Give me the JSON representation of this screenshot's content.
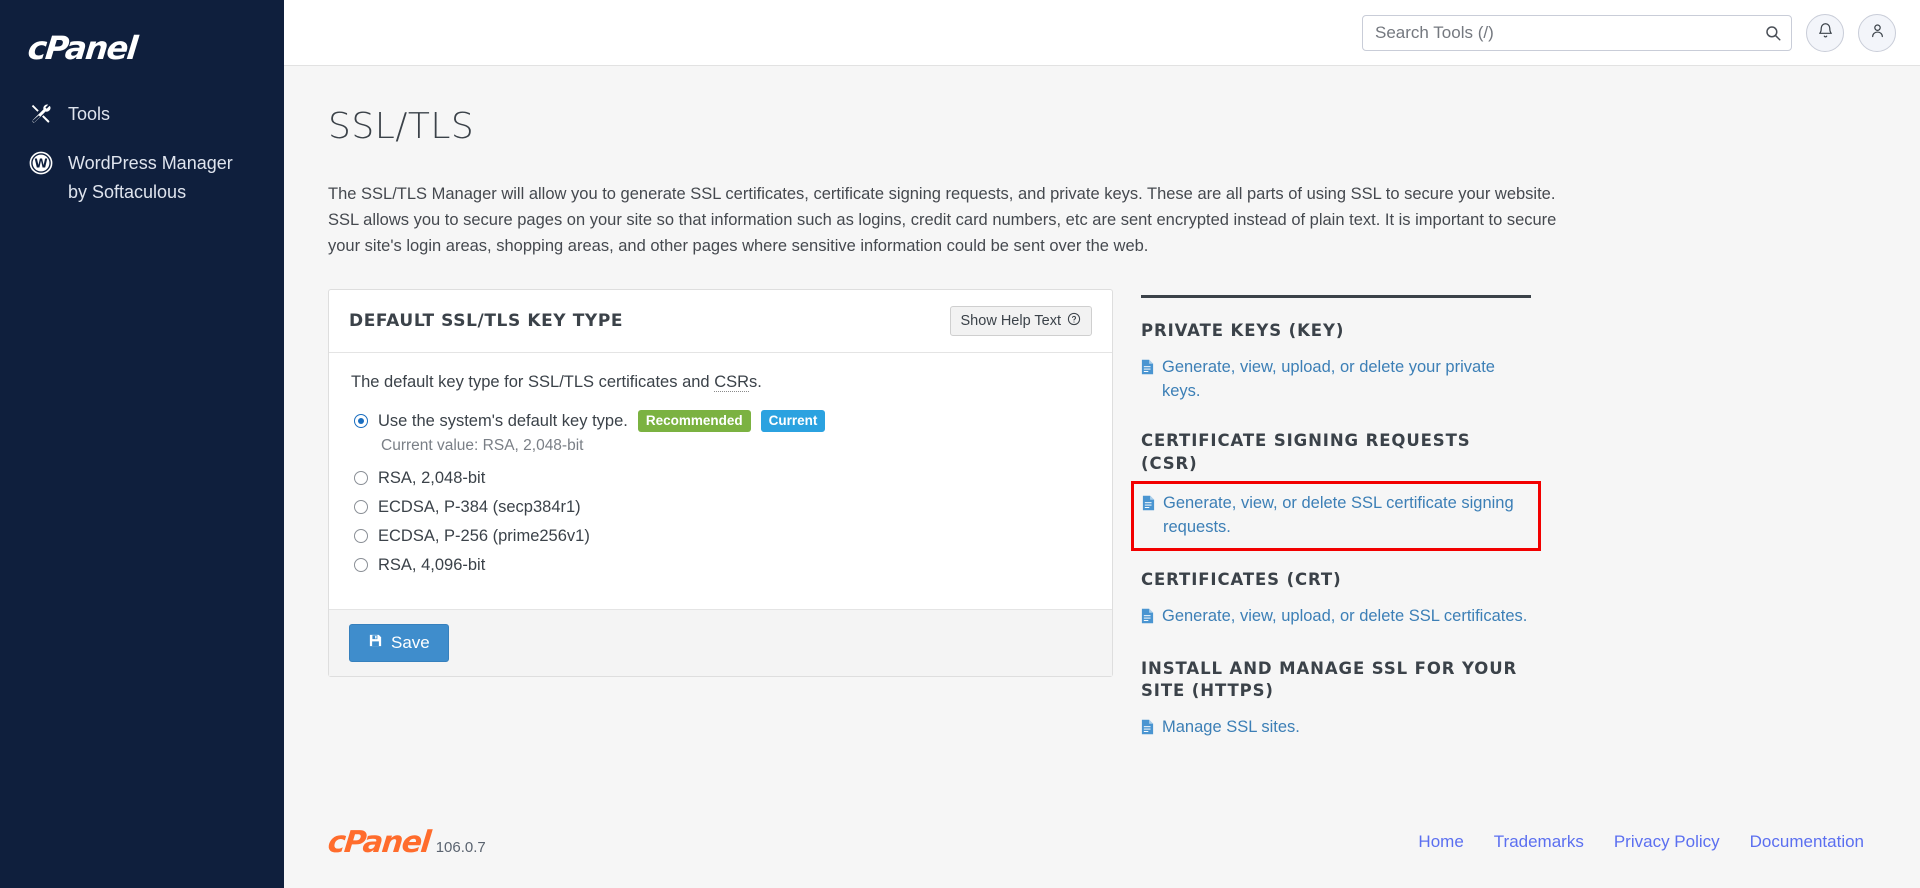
{
  "sidebar": {
    "brand": "cPanel",
    "items": [
      {
        "label": "Tools",
        "icon": "tools-icon"
      },
      {
        "label": "WordPress Manager by Softaculous",
        "icon": "wordpress-icon"
      }
    ]
  },
  "header": {
    "search_placeholder": "Search Tools (/)",
    "search_value": "",
    "search_icon": "search-icon",
    "notifications_icon": "bell-icon",
    "account_icon": "user-icon"
  },
  "main": {
    "page_title": "SSL/TLS",
    "intro": "The SSL/TLS Manager will allow you to generate SSL certificates, certificate signing requests, and private keys. These are all parts of using SSL to secure your website. SSL allows you to secure pages on your site so that information such as logins, credit card numbers, etc are sent encrypted instead of plain text. It is important to secure your site's login areas, shopping areas, and other pages where sensitive information could be sent over the web."
  },
  "panel": {
    "title": "DEFAULT SSL/TLS KEY TYPE",
    "help_label": "Show Help Text",
    "help_icon": "question-circle-icon",
    "field_description_pre": "The default key type for SSL/TLS certificates and ",
    "field_description_abbr": "CSR",
    "field_description_post": "s.",
    "options": [
      {
        "label": "Use the system's default key type.",
        "selected": true,
        "badges": [
          {
            "text": "Recommended",
            "color": "#7bb241"
          },
          {
            "text": "Current",
            "color": "#2ba2e0"
          }
        ],
        "sub_label": "Current value: RSA, 2,048-bit"
      },
      {
        "label": "RSA, 2,048-bit",
        "selected": false,
        "badges": [],
        "sub_label": ""
      },
      {
        "label": "ECDSA, P-384 (secp384r1)",
        "selected": false,
        "badges": [],
        "sub_label": ""
      },
      {
        "label": "ECDSA, P-256 (prime256v1)",
        "selected": false,
        "badges": [],
        "sub_label": ""
      },
      {
        "label": "RSA, 4,096-bit",
        "selected": false,
        "badges": [],
        "sub_label": ""
      }
    ],
    "save_label": "Save",
    "save_icon": "floppy-disk-icon"
  },
  "right_column": {
    "sections": [
      {
        "title": "PRIVATE KEYS (KEY)",
        "link": "Generate, view, upload, or delete your private keys.",
        "highlighted": false
      },
      {
        "title": "CERTIFICATE SIGNING REQUESTS (CSR)",
        "link": "Generate, view, or delete SSL certificate signing requests.",
        "highlighted": true
      },
      {
        "title": "CERTIFICATES (CRT)",
        "link": "Generate, view, upload, or delete SSL certificates.",
        "highlighted": false
      },
      {
        "title": "INSTALL AND MANAGE SSL FOR YOUR SITE (HTTPS)",
        "link": "Manage SSL sites.",
        "highlighted": false
      }
    ],
    "highlight_color": "#f20000"
  },
  "footer": {
    "logo": "cPanel",
    "version": "106.0.7",
    "links": [
      "Home",
      "Trademarks",
      "Privacy Policy",
      "Documentation"
    ]
  }
}
